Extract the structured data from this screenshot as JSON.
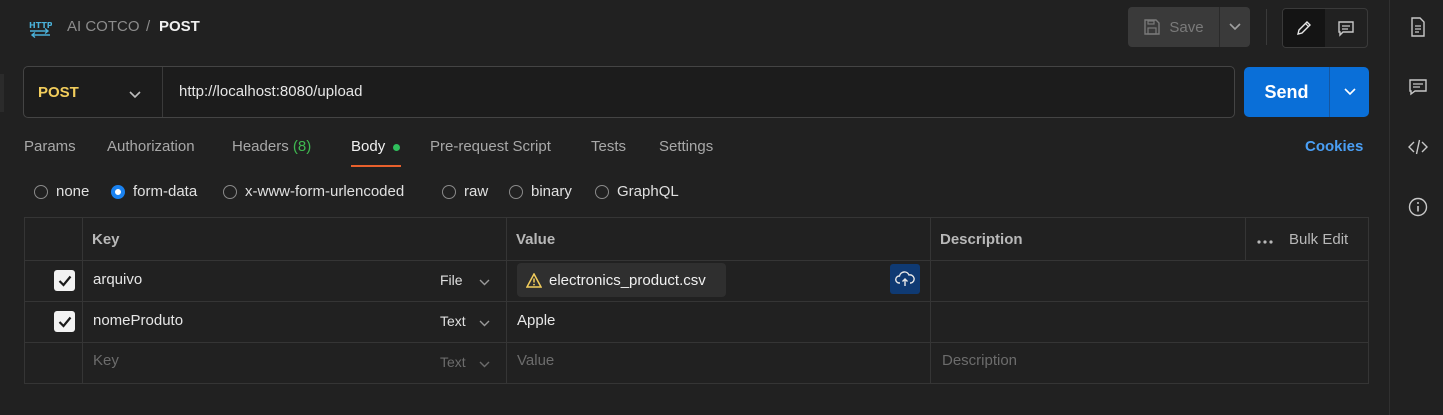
{
  "breadcrumb": {
    "parent": "AI COTCO",
    "separator": "/",
    "current": "POST"
  },
  "toolbar": {
    "save_label": "Save"
  },
  "request": {
    "method": "POST",
    "url": "http://localhost:8080/upload",
    "send_label": "Send"
  },
  "tabs": [
    {
      "label": "Params"
    },
    {
      "label": "Authorization"
    },
    {
      "label": "Headers",
      "count": "(8)"
    },
    {
      "label": "Body"
    },
    {
      "label": "Pre-request Script"
    },
    {
      "label": "Tests"
    },
    {
      "label": "Settings"
    }
  ],
  "cookies_label": "Cookies",
  "body_types": [
    {
      "label": "none",
      "selected": false
    },
    {
      "label": "form-data",
      "selected": true
    },
    {
      "label": "x-www-form-urlencoded",
      "selected": false
    },
    {
      "label": "raw",
      "selected": false
    },
    {
      "label": "binary",
      "selected": false
    },
    {
      "label": "GraphQL",
      "selected": false
    }
  ],
  "table": {
    "headers": {
      "key": "Key",
      "value": "Value",
      "description": "Description",
      "bulk_edit": "Bulk Edit"
    },
    "rows": [
      {
        "checked": true,
        "key": "arquivo",
        "type": "File",
        "value": "electronics_product.csv"
      },
      {
        "checked": true,
        "key": "nomeProduto",
        "type": "Text",
        "value": "Apple"
      }
    ],
    "placeholder": {
      "key": "Key",
      "type": "Text",
      "value": "Value",
      "description": "Description"
    }
  },
  "colors": {
    "accent": "#0a6fd8",
    "method": "#f2cd5c",
    "tab_underline": "#e8602c",
    "success": "#2fbf5c"
  }
}
